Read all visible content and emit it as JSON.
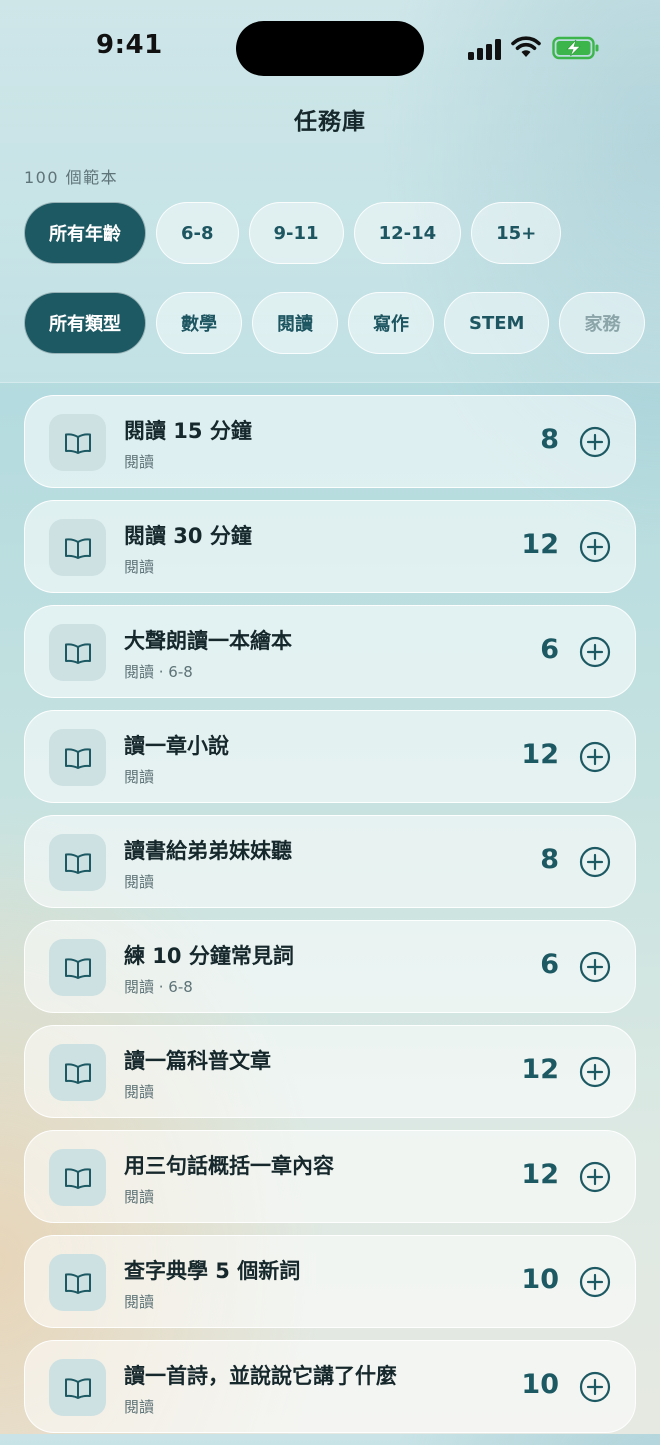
{
  "status_bar": {
    "time": "9:41"
  },
  "header": {
    "title": "任務庫",
    "template_count": "100 個範本"
  },
  "age_filters": [
    {
      "label": "所有年齡",
      "active": true
    },
    {
      "label": "6-8",
      "active": false
    },
    {
      "label": "9-11",
      "active": false
    },
    {
      "label": "12-14",
      "active": false
    },
    {
      "label": "15+",
      "active": false
    }
  ],
  "type_filters": [
    {
      "label": "所有類型",
      "active": true
    },
    {
      "label": "數學",
      "active": false
    },
    {
      "label": "閱讀",
      "active": false
    },
    {
      "label": "寫作",
      "active": false
    },
    {
      "label": "STEM",
      "active": false
    },
    {
      "label": "家務",
      "active": false
    }
  ],
  "tasks": [
    {
      "title": "閱讀 15 分鐘",
      "subtitle": "閱讀",
      "points": "8",
      "icon": "book-icon"
    },
    {
      "title": "閱讀 30 分鐘",
      "subtitle": "閱讀",
      "points": "12",
      "icon": "book-icon"
    },
    {
      "title": "大聲朗讀一本繪本",
      "subtitle": "閱讀 · 6-8",
      "points": "6",
      "icon": "book-icon"
    },
    {
      "title": "讀一章小說",
      "subtitle": "閱讀",
      "points": "12",
      "icon": "book-icon"
    },
    {
      "title": "讀書給弟弟妹妹聽",
      "subtitle": "閱讀",
      "points": "8",
      "icon": "book-icon"
    },
    {
      "title": "練 10 分鐘常見詞",
      "subtitle": "閱讀 · 6-8",
      "points": "6",
      "icon": "book-icon"
    },
    {
      "title": "讀一篇科普文章",
      "subtitle": "閱讀",
      "points": "12",
      "icon": "book-icon"
    },
    {
      "title": "用三句話概括一章內容",
      "subtitle": "閱讀",
      "points": "12",
      "icon": "book-icon"
    },
    {
      "title": "查字典學 5 個新詞",
      "subtitle": "閱讀",
      "points": "10",
      "icon": "book-icon"
    },
    {
      "title": "讀一首詩，並說說它講了什麼",
      "subtitle": "閱讀",
      "points": "10",
      "icon": "book-icon"
    }
  ],
  "colors": {
    "accent": "#1d5963",
    "chip_text": "#1d5560"
  }
}
